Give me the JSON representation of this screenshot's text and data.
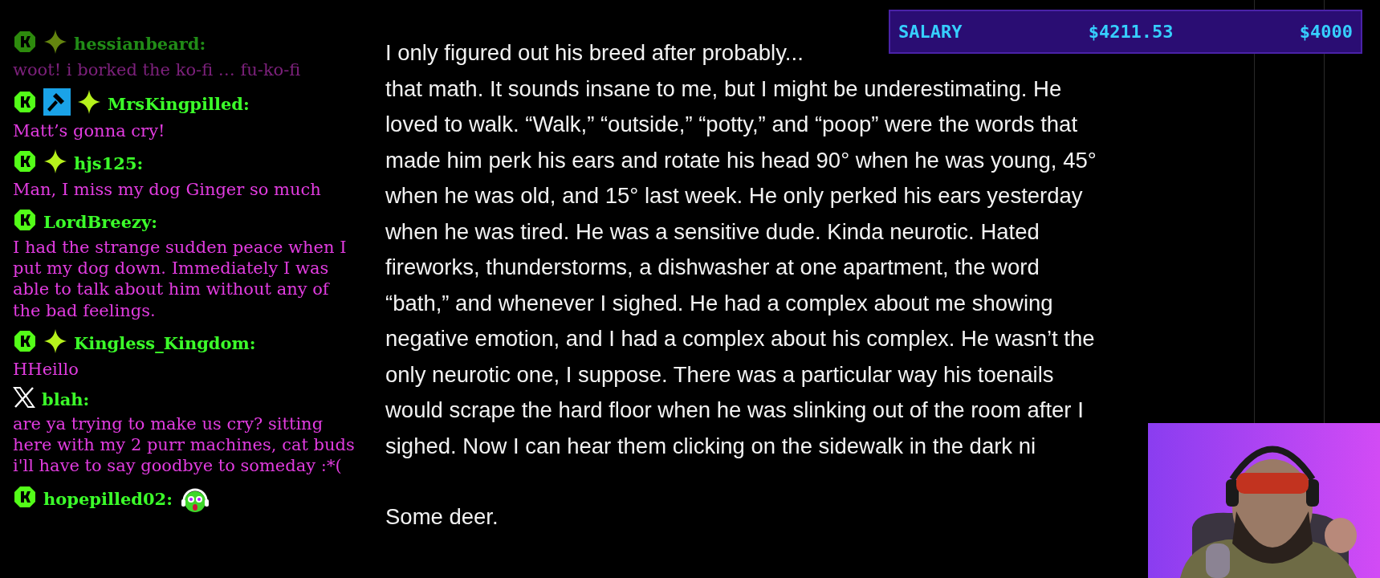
{
  "chat": [
    {
      "badges": [
        {
          "kind": "kick"
        },
        {
          "kind": "sparkle"
        }
      ],
      "user": "hessianbeard:",
      "text": "woot! i borked the ko-fi … fu-ko-fi",
      "faded": true,
      "has_emote": false
    },
    {
      "badges": [
        {
          "kind": "kick"
        },
        {
          "kind": "hammer"
        },
        {
          "kind": "sparkle"
        }
      ],
      "user": "MrsKingpilled:",
      "text": "Matt’s gonna cry!",
      "faded": false,
      "has_emote": false
    },
    {
      "badges": [
        {
          "kind": "kick"
        },
        {
          "kind": "sparkle"
        }
      ],
      "user": "hjs125:",
      "text": "Man, I miss my dog Ginger so much",
      "faded": false,
      "has_emote": false
    },
    {
      "badges": [
        {
          "kind": "kick"
        }
      ],
      "user": "LordBreezy:",
      "text": "I had the strange sudden peace when I put my dog down. Immediately I was able to talk about him without any of the bad feelings.",
      "faded": false,
      "has_emote": false
    },
    {
      "badges": [
        {
          "kind": "kick"
        },
        {
          "kind": "sparkle"
        }
      ],
      "user": "Kingless_Kingdom:",
      "text": "HHeillo",
      "faded": false,
      "has_emote": false
    },
    {
      "badges": [
        {
          "kind": "x"
        }
      ],
      "user": "blah:",
      "text": "are ya trying to make us cry? sitting here with my 2 purr machines, cat buds i'll have to say goodbye to someday :*(",
      "faded": false,
      "has_emote": false
    },
    {
      "badges": [
        {
          "kind": "kick"
        }
      ],
      "user": "hopepilled02:",
      "faded": false,
      "has_emote": true
    }
  ],
  "article": {
    "paragraphs": [
      [
        "I only figured out his breed after probably...",
        "that math. It sounds insane to me, but I might be underestimating. He",
        "loved to walk. “Walk,” “outside,” “potty,” and “poop” were the words that",
        "made him perk his ears and rotate his head 90° when he was young, 45°",
        "when he was old, and 15° last week. He only perked his ears yesterday",
        "when he was tired. He was a sensitive dude. Kinda neurotic. Hated",
        "fireworks, thunderstorms, a dishwasher at one apartment, the word",
        "“bath,” and whenever I sighed. He had a complex about me showing",
        "negative emotion, and I had a complex about his complex. He wasn’t the",
        "only neurotic one, I suppose. There was a particular way his toenails",
        "would scrape the hard floor when he was slinking out of the room after I",
        "sighed. Now I can hear them clicking on the sidewalk in the dark ni"
      ],
      [
        "Some deer."
      ]
    ]
  },
  "salary": {
    "label": "SALARY",
    "current": "$4211.53",
    "goal": "$4000"
  }
}
